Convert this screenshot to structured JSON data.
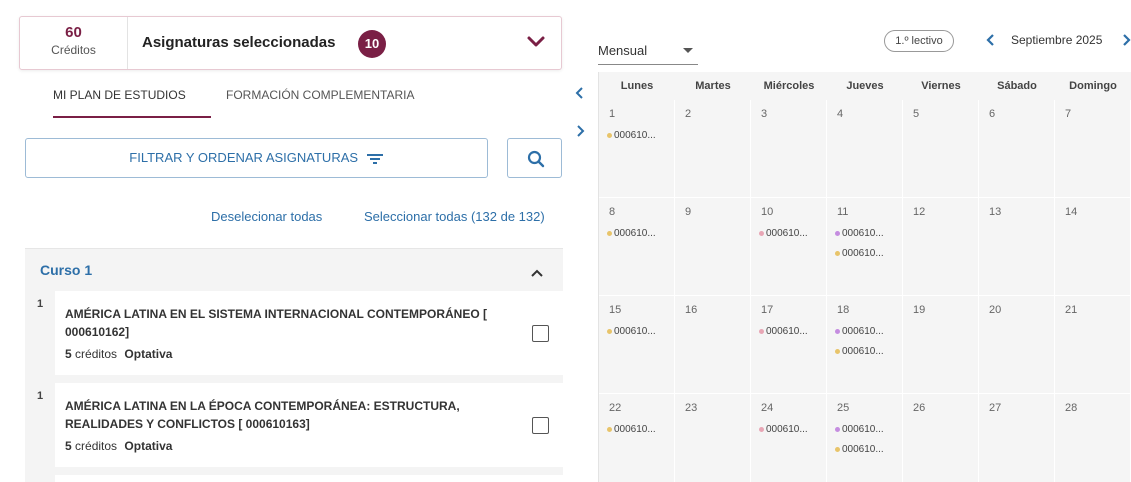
{
  "summary": {
    "credits_value": "60",
    "credits_label": "Créditos",
    "title": "Asignaturas seleccionadas",
    "count": "10",
    "accent_color": "#7a1f45"
  },
  "tabs": [
    {
      "label": "MI PLAN DE ESTUDIOS",
      "active": true
    },
    {
      "label": "FORMACIÓN COMPLEMENTARIA",
      "active": false
    }
  ],
  "filter": {
    "filter_label": "FILTRAR Y ORDENAR ASIGNATURAS",
    "deselect_all": "Deselecionar todas",
    "select_all": "Seleccionar todas (132 de 132)"
  },
  "course": {
    "title": "Curso 1",
    "subjects": [
      {
        "index": "1",
        "name": "AMÉRICA LATINA EN EL SISTEMA INTERNACIONAL CONTEMPORÁNEO [ 000610162]",
        "credits": "5",
        "credits_label": "créditos",
        "type": "Optativa",
        "checked": false
      },
      {
        "index": "1",
        "name": "AMÉRICA LATINA EN LA ÉPOCA CONTEMPORÁNEA: ESTRUCTURA, REALIDADES Y CONFLICTOS [ 000610163]",
        "credits": "5",
        "credits_label": "créditos",
        "type": "Optativa",
        "checked": false
      }
    ]
  },
  "calendar": {
    "view": "Mensual",
    "period": "1.º lectivo",
    "month": "Septiembre 2025",
    "weekdays": [
      "Lunes",
      "Martes",
      "Miércoles",
      "Jueves",
      "Viernes",
      "Sábado",
      "Domingo"
    ],
    "weeks": [
      {
        "days": [
          {
            "day": "1",
            "events": [
              {
                "label": "000610...",
                "color": "yellow"
              }
            ]
          },
          {
            "day": "2",
            "events": []
          },
          {
            "day": "3",
            "events": []
          },
          {
            "day": "4",
            "events": []
          },
          {
            "day": "5",
            "events": []
          },
          {
            "day": "6",
            "events": []
          },
          {
            "day": "7",
            "events": []
          }
        ]
      },
      {
        "days": [
          {
            "day": "8",
            "events": [
              {
                "label": "000610...",
                "color": "yellow"
              }
            ]
          },
          {
            "day": "9",
            "events": []
          },
          {
            "day": "10",
            "events": [
              {
                "label": "000610...",
                "color": "pink"
              }
            ]
          },
          {
            "day": "11",
            "events": [
              {
                "label": "000610...",
                "color": "purple"
              },
              {
                "label": "000610...",
                "color": "yellow"
              }
            ]
          },
          {
            "day": "12",
            "events": []
          },
          {
            "day": "13",
            "events": []
          },
          {
            "day": "14",
            "events": []
          }
        ]
      },
      {
        "days": [
          {
            "day": "15",
            "events": [
              {
                "label": "000610...",
                "color": "yellow"
              }
            ]
          },
          {
            "day": "16",
            "events": []
          },
          {
            "day": "17",
            "events": [
              {
                "label": "000610...",
                "color": "pink"
              }
            ]
          },
          {
            "day": "18",
            "events": [
              {
                "label": "000610...",
                "color": "purple"
              },
              {
                "label": "000610...",
                "color": "yellow"
              }
            ]
          },
          {
            "day": "19",
            "events": []
          },
          {
            "day": "20",
            "events": []
          },
          {
            "day": "21",
            "events": []
          }
        ]
      },
      {
        "days": [
          {
            "day": "22",
            "events": [
              {
                "label": "000610...",
                "color": "yellow"
              }
            ]
          },
          {
            "day": "23",
            "events": []
          },
          {
            "day": "24",
            "events": [
              {
                "label": "000610...",
                "color": "pink"
              }
            ]
          },
          {
            "day": "25",
            "events": [
              {
                "label": "000610...",
                "color": "purple"
              },
              {
                "label": "000610...",
                "color": "yellow"
              }
            ]
          },
          {
            "day": "26",
            "events": []
          },
          {
            "day": "27",
            "events": []
          },
          {
            "day": "28",
            "events": []
          }
        ]
      }
    ]
  }
}
